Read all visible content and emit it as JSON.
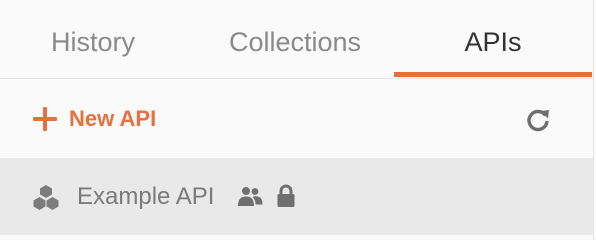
{
  "tabs": [
    {
      "label": "History",
      "active": false
    },
    {
      "label": "Collections",
      "active": false
    },
    {
      "label": "APIs",
      "active": true
    }
  ],
  "toolbar": {
    "new_label": "New API",
    "refresh_icon": "refresh-icon"
  },
  "apis": [
    {
      "name": "Example API",
      "icon": "api-cubes-icon",
      "shared": true,
      "locked": true
    }
  ],
  "colors": {
    "accent": "#e8703e",
    "active_tab_text": "#333333",
    "inactive_tab_text": "#8a8a8a",
    "selected_row_bg": "#e9e9e9",
    "panel_bg": "#fafafa"
  }
}
